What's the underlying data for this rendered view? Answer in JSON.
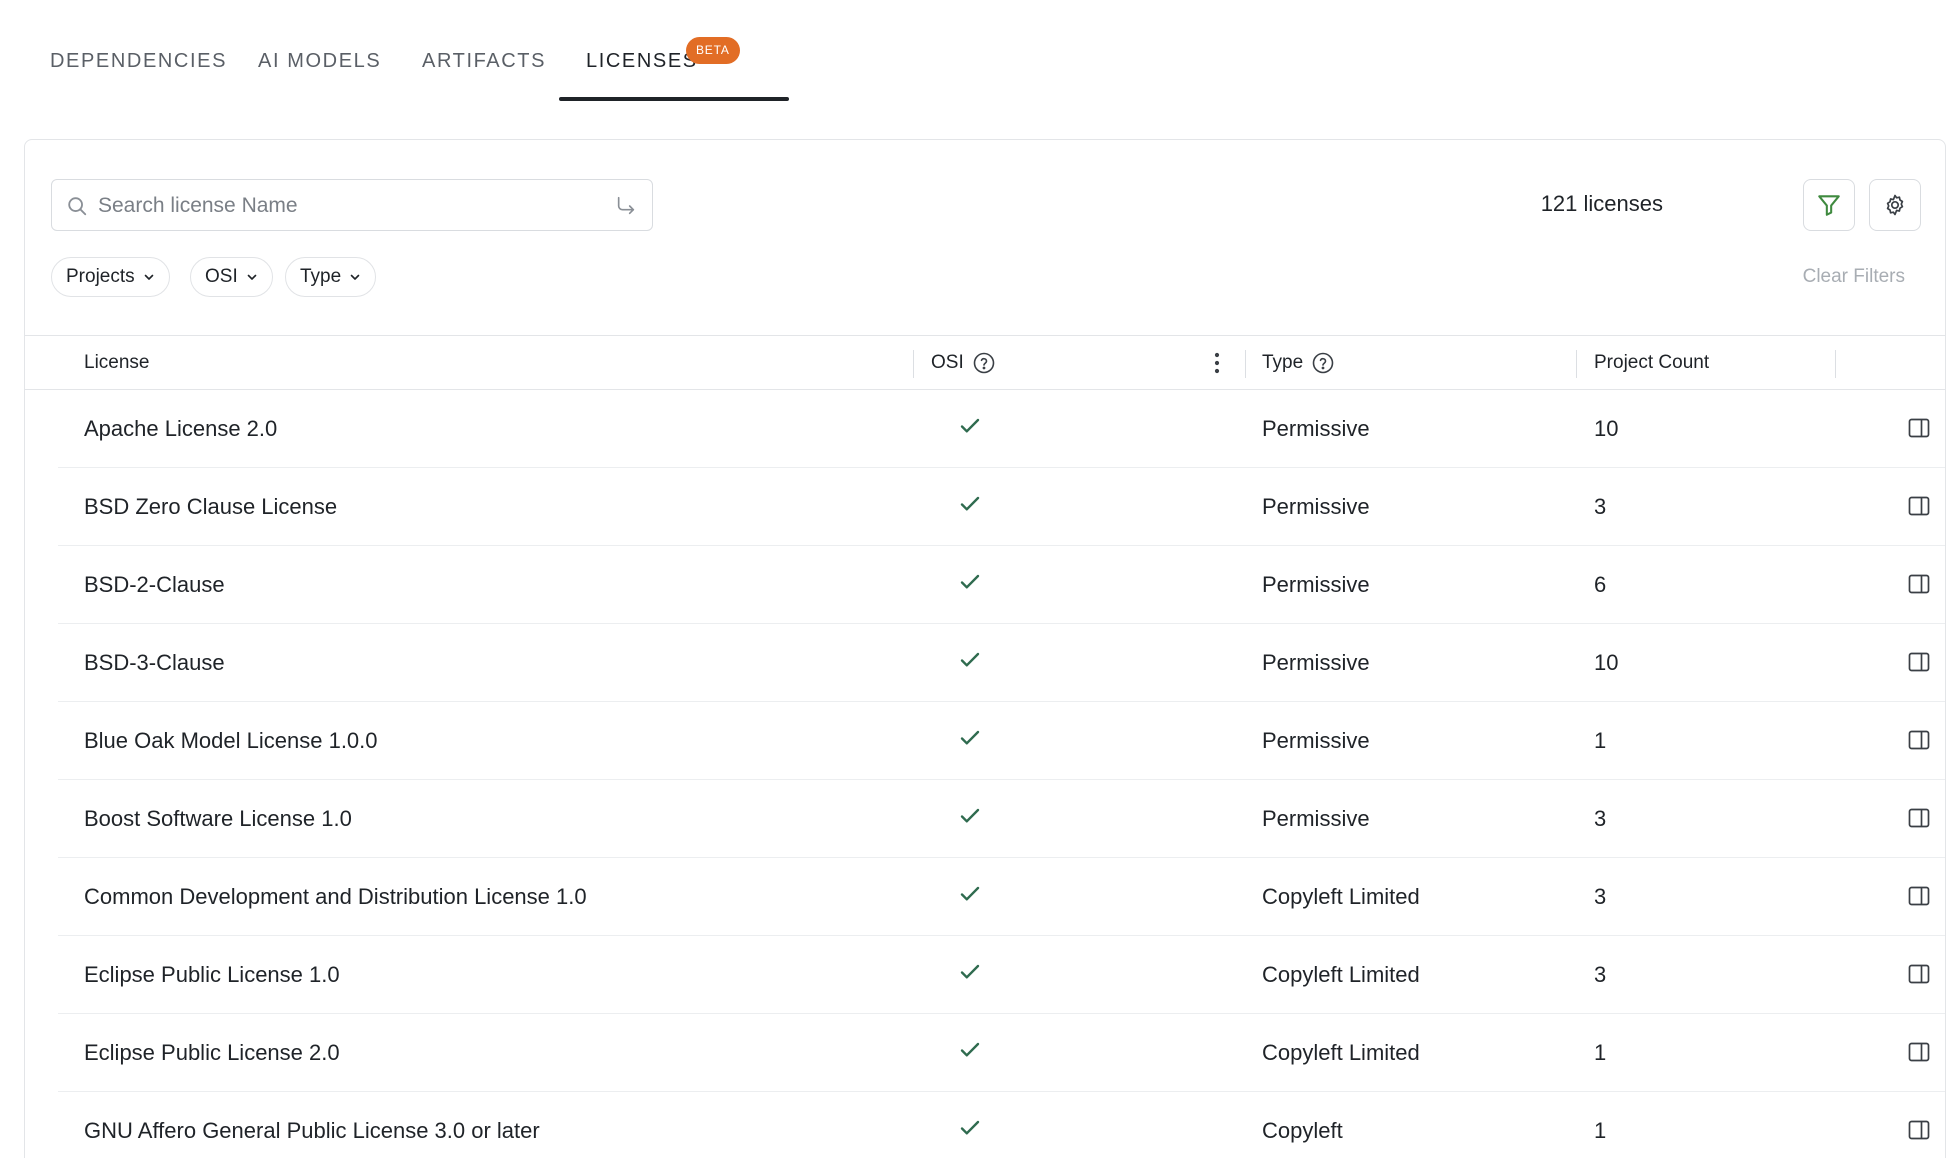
{
  "tabs": [
    {
      "label": "DEPENDENCIES",
      "active": false
    },
    {
      "label": "AI MODELS",
      "active": false
    },
    {
      "label": "ARTIFACTS",
      "active": false
    },
    {
      "label": "LICENSES",
      "active": true
    }
  ],
  "beta_badge": "BETA",
  "search": {
    "placeholder": "Search license Name",
    "value": ""
  },
  "license_count": "121 licenses",
  "filter_chips": [
    "Projects",
    "OSI",
    "Type"
  ],
  "clear_filters": "Clear Filters",
  "table": {
    "headers": {
      "license": "License",
      "osi": "OSI",
      "type": "Type",
      "project_count": "Project Count"
    },
    "rows": [
      {
        "license": "Apache License 2.0",
        "osi": true,
        "type": "Permissive",
        "project_count": "10"
      },
      {
        "license": "BSD Zero Clause License",
        "osi": true,
        "type": "Permissive",
        "project_count": "3"
      },
      {
        "license": "BSD-2-Clause",
        "osi": true,
        "type": "Permissive",
        "project_count": "6"
      },
      {
        "license": "BSD-3-Clause",
        "osi": true,
        "type": "Permissive",
        "project_count": "10"
      },
      {
        "license": "Blue Oak Model License 1.0.0",
        "osi": true,
        "type": "Permissive",
        "project_count": "1"
      },
      {
        "license": "Boost Software License 1.0",
        "osi": true,
        "type": "Permissive",
        "project_count": "3"
      },
      {
        "license": "Common Development and Distribution License 1.0",
        "osi": true,
        "type": "Copyleft Limited",
        "project_count": "3"
      },
      {
        "license": "Eclipse Public License 1.0",
        "osi": true,
        "type": "Copyleft Limited",
        "project_count": "3"
      },
      {
        "license": "Eclipse Public License 2.0",
        "osi": true,
        "type": "Copyleft Limited",
        "project_count": "1"
      },
      {
        "license": "GNU Affero General Public License 3.0 or later",
        "osi": true,
        "type": "Copyleft",
        "project_count": "1"
      }
    ]
  },
  "colors": {
    "accent": "#e26d25",
    "check": "#2f6b4f",
    "filter_icon": "#3f8a3f",
    "muted": "#a8adb3"
  },
  "icons": {
    "search": "search-icon",
    "enter": "enter-arrow-icon",
    "filter": "filter-icon",
    "settings": "gear-icon",
    "chip": "chevron-down-icon",
    "help": "help-circle-icon",
    "menu": "kebab-menu-icon",
    "check": "check-icon",
    "panel": "side-panel-icon"
  }
}
